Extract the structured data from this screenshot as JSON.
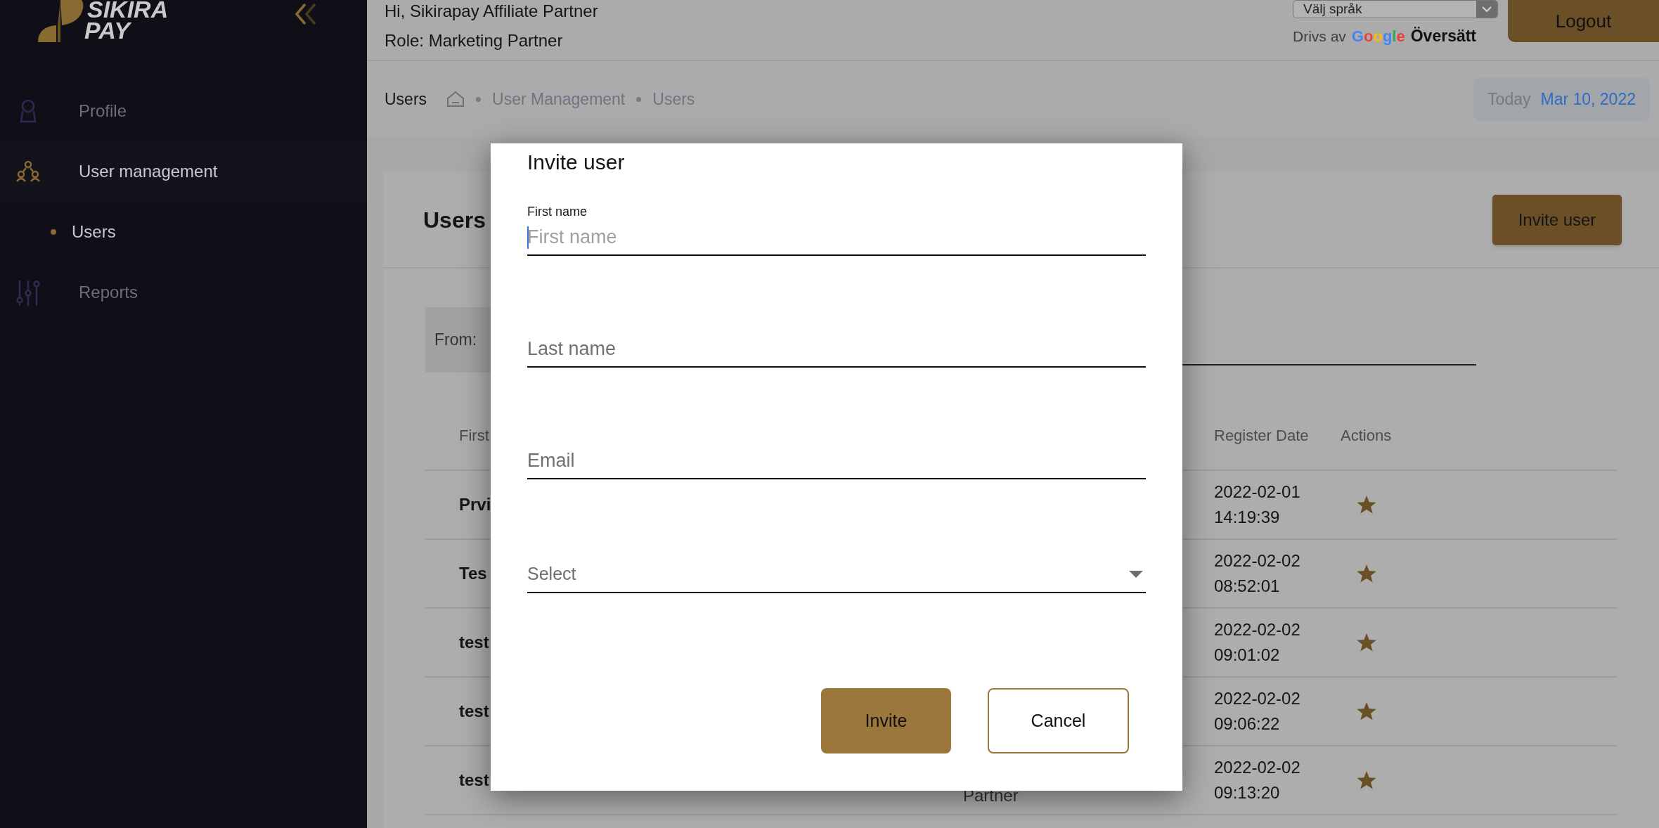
{
  "logo": {
    "line_1": "SIKIRA",
    "line_2": "PAY"
  },
  "sidebar": {
    "items": [
      {
        "label": "Profile",
        "selected": false
      },
      {
        "label": "User management",
        "selected": true,
        "children": [
          {
            "label": "Users",
            "selected": true
          }
        ]
      },
      {
        "label": "Reports",
        "selected": false
      }
    ]
  },
  "header": {
    "greeting": "Hi, Sikirapay Affiliate Partner",
    "role": "Role: Marketing Partner",
    "language_select": "Välj språk",
    "powered_by": "Drivs av",
    "google": "Google",
    "translate": "Översätt",
    "logout": "Logout"
  },
  "breadcrumb": {
    "page_title": "Users",
    "items": [
      "User Management",
      "Users"
    ]
  },
  "today": {
    "label": "Today",
    "date": "Mar 10, 2022"
  },
  "card": {
    "title": "Users",
    "invite_button": "Invite user"
  },
  "filter": {
    "label": "From:"
  },
  "table": {
    "columns": [
      "First",
      "Register Date",
      "Actions"
    ],
    "rows": [
      {
        "first": "Prvi",
        "register_date": "2022-02-01",
        "register_time": "14:19:39"
      },
      {
        "first": "Tes",
        "register_date": "2022-02-02",
        "register_time": "08:52:01"
      },
      {
        "first": "test",
        "register_date": "2022-02-02",
        "register_time": "09:01:02"
      },
      {
        "first": "test",
        "register_date": "2022-02-02",
        "register_time": "09:06:22"
      },
      {
        "first": "test",
        "column_3": "Partner",
        "register_date": "2022-02-02",
        "register_time": "09:13:20"
      }
    ]
  },
  "modal": {
    "title": "Invite user",
    "fields": [
      {
        "kind": "text",
        "label": "First name",
        "placeholder": "First name",
        "focused": true
      },
      {
        "kind": "text",
        "placeholder": "Last name",
        "focused": false
      },
      {
        "kind": "text",
        "placeholder": "Email",
        "focused": false
      },
      {
        "kind": "select",
        "placeholder": "Select"
      }
    ],
    "buttons": [
      {
        "kind": "primary",
        "label": "Invite"
      },
      {
        "kind": "secondary",
        "label": "Cancel"
      }
    ]
  }
}
